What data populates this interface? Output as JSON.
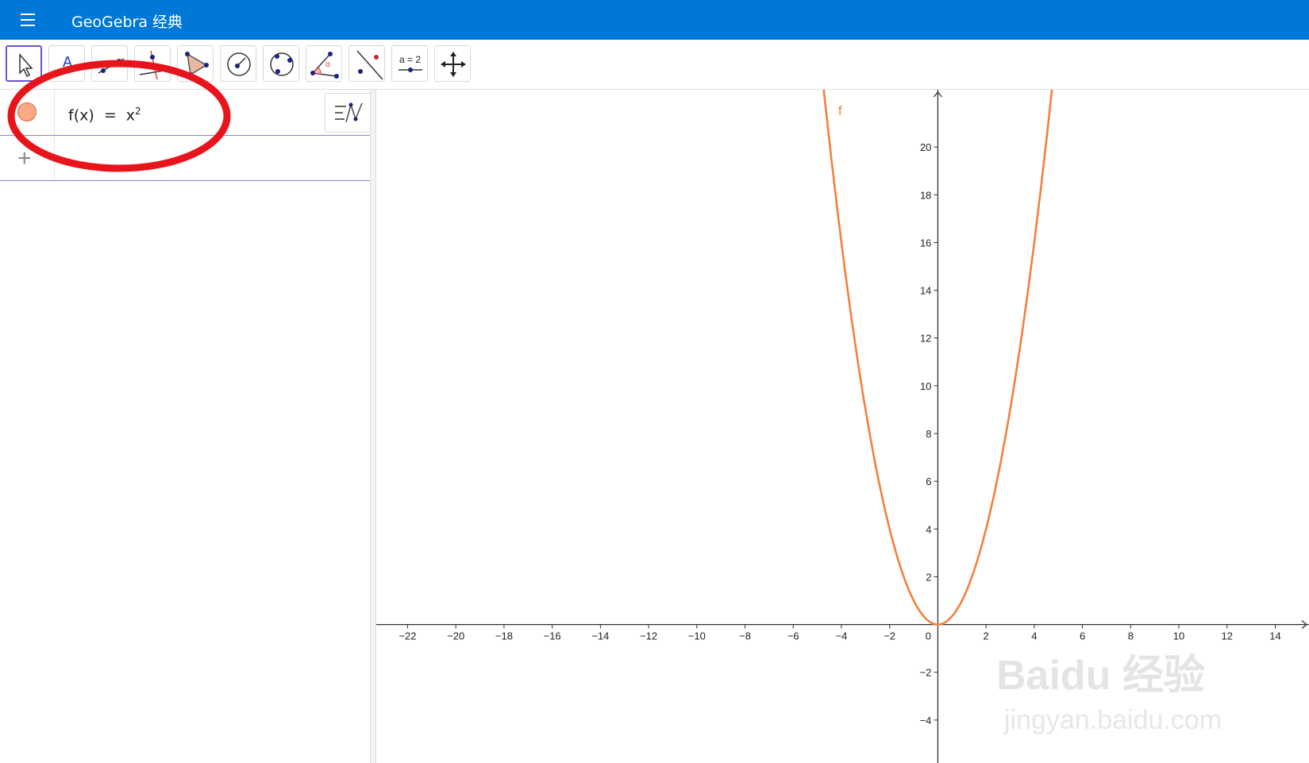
{
  "header": {
    "title": "GeoGebra 经典"
  },
  "toolbar": {
    "tools": [
      {
        "name": "move-tool",
        "icon": "arrow-cursor-icon"
      },
      {
        "name": "point-tool",
        "icon": "point-a-icon",
        "label": "A"
      },
      {
        "name": "line-tool",
        "icon": "line-icon"
      },
      {
        "name": "perpendicular-line-tool",
        "icon": "perpendicular-icon"
      },
      {
        "name": "polygon-tool",
        "icon": "polygon-icon"
      },
      {
        "name": "circle-center-point-tool",
        "icon": "circle-center-icon"
      },
      {
        "name": "circle-three-points-tool",
        "icon": "circle-three-points-icon"
      },
      {
        "name": "angle-tool",
        "icon": "angle-icon",
        "label": "α"
      },
      {
        "name": "reflect-tool",
        "icon": "reflect-line-icon"
      },
      {
        "name": "slider-tool",
        "icon": "slider-icon",
        "label": "a = 2"
      },
      {
        "name": "move-graphics-view-tool",
        "icon": "move-cross-icon"
      }
    ]
  },
  "algebra": {
    "rows": [
      {
        "lhs": "f(x)",
        "eq": "=",
        "base": "x",
        "exponent": "2",
        "color": "#f9a984"
      }
    ],
    "add_symbol": "+"
  },
  "chart_data": {
    "type": "line",
    "series": [
      {
        "name": "f",
        "function": "x^2",
        "color": "#f2803b"
      }
    ],
    "xlim": [
      -23.3,
      15.4
    ],
    "ylim": [
      -5.8,
      22.4
    ],
    "xticks": [
      -22,
      -20,
      -18,
      -16,
      -14,
      -12,
      -10,
      -8,
      -6,
      -4,
      -2,
      0,
      2,
      4,
      6,
      8,
      10,
      12,
      14
    ],
    "yticks": [
      -4,
      -2,
      2,
      4,
      6,
      8,
      10,
      12,
      14,
      16,
      18,
      20
    ],
    "origin_label": "0",
    "grid": false
  },
  "watermark": {
    "text1": "Baidu 经验",
    "text2": "jingyan.baidu.com"
  }
}
